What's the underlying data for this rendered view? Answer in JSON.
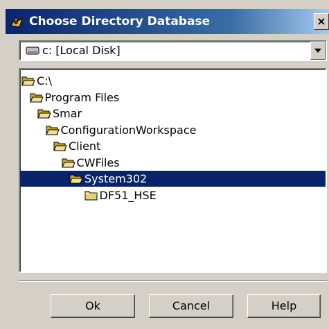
{
  "window": {
    "title": "Choose Directory Database",
    "close_label": "×"
  },
  "drive": {
    "selected": "c: [Local Disk]"
  },
  "tree": {
    "items": [
      {
        "label": "C:\\",
        "level": 0,
        "icon": "open-folder-icon",
        "selected": false
      },
      {
        "label": "Program Files",
        "level": 1,
        "icon": "open-folder-icon",
        "selected": false
      },
      {
        "label": "Smar",
        "level": 2,
        "icon": "open-folder-icon",
        "selected": false
      },
      {
        "label": "ConfigurationWorkspace",
        "level": 3,
        "icon": "open-folder-icon",
        "selected": false
      },
      {
        "label": "Client",
        "level": 4,
        "icon": "open-folder-icon",
        "selected": false
      },
      {
        "label": "CWFiles",
        "level": 5,
        "icon": "open-folder-icon",
        "selected": false
      },
      {
        "label": "System302",
        "level": 6,
        "icon": "open-folder-icon",
        "selected": true
      },
      {
        "label": "DF51_HSE",
        "level": 7,
        "icon": "closed-folder-icon",
        "selected": false
      }
    ]
  },
  "buttons": {
    "ok": "Ok",
    "cancel": "Cancel",
    "help": "Help"
  },
  "colors": {
    "titlebar_start": "#0a246a",
    "titlebar_end": "#a6caf0",
    "selection": "#0a246a",
    "folder": "#e8d070",
    "face": "#d4d0c8"
  }
}
